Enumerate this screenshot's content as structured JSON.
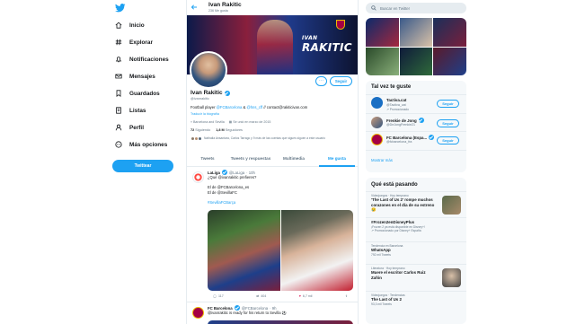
{
  "nav": {
    "items": [
      {
        "label": "Inicio",
        "icon": "home-icon"
      },
      {
        "label": "Explorar",
        "icon": "hashtag-icon"
      },
      {
        "label": "Notificaciones",
        "icon": "bell-icon"
      },
      {
        "label": "Mensajes",
        "icon": "envelope-icon"
      },
      {
        "label": "Guardados",
        "icon": "bookmark-icon"
      },
      {
        "label": "Listas",
        "icon": "list-icon"
      },
      {
        "label": "Perfil",
        "icon": "person-icon"
      },
      {
        "label": "Más opciones",
        "icon": "more-icon"
      }
    ],
    "tweet_button": "Twittear"
  },
  "header": {
    "name": "Ivan Rakitic",
    "count": "236 Me gusta"
  },
  "banner": {
    "first": "IVAN",
    "last": "RAKITIC"
  },
  "profile": {
    "more": "···",
    "follow": "Seguir",
    "name": "Ivan Rakitic",
    "handle": "@ivanrakitic",
    "bio_pre": "Football player ",
    "bio_link1": "@FCBarcelona",
    "bio_mid": " & ",
    "bio_link2": "@hns_cff",
    "bio_post": " // contact@rakiticivan.com",
    "translate": "Traducir la biografía",
    "location": "Barcelona and Sevilla",
    "joined": "Se unió en marzo de 2015",
    "following_num": "72",
    "following_label": "Siguiendo",
    "followers_num": "1,8 M",
    "followers_label": "Seguidores",
    "known": "Nathalia Ansantara, Carlos Tarrago y 9 más de las cuentas que sigues siguen a este usuario"
  },
  "tabs": [
    "Tweets",
    "Tweets y respuestas",
    "Multimedia",
    "Me gusta"
  ],
  "tweet1": {
    "name": "LaLiga",
    "handle": "@LaLiga",
    "time": "· 10h",
    "line1": "¿Qué @ivanrakitic prefieres?",
    "line2": "El de @FCBarcelona_es",
    "line3": "El de @SevillaFC",
    "hashtag": "#SevillaFCBarça",
    "reply": "117",
    "retweet": "404",
    "like": "6,7 mil"
  },
  "tweet2": {
    "name": "FC Barcelona",
    "handle": "@FCBarcelona",
    "time": "· 9h",
    "line1": "@ivanrakitic is ready for his return to Sevilla ⚽"
  },
  "search": {
    "placeholder": "Buscar en Twitter"
  },
  "who_to_follow": {
    "title": "Tal vez te guste",
    "items": [
      {
        "name": "Tactiva.cat",
        "handle": "@Tactiva_cat",
        "promo": "Promocionado",
        "button": "Seguir"
      },
      {
        "name": "Frenkie de Jong",
        "handle": "@DeJongFrenkie21",
        "promo": "",
        "button": "Seguir"
      },
      {
        "name": "FC Barcelona (Espa...",
        "handle": "@fcbarcelona_fra",
        "promo": "",
        "button": "Seguir"
      }
    ],
    "show_more": "Mostrar más"
  },
  "trends": {
    "title": "Qué está pasando",
    "items": [
      {
        "context": "Videojuegos · Hoy temprano",
        "title": "'The Last of Us 2' rompe muchos corazones en el día de su estreno 😢",
        "sub": ""
      },
      {
        "context": "",
        "title": "#Frozen2enDisneyPlus",
        "sub": "¡Frozen 2 ya está disponible en Disney+!"
      },
      {
        "context": "",
        "title": "",
        "sub": "Promocionado por Disney+ España"
      },
      {
        "context": "Tendencia en Barcelona",
        "title": "WhatsApp",
        "sub": "792 mil Tweets"
      },
      {
        "context": "Literatura · Hoy temprano",
        "title": "Muere el escritor Carlos Ruiz Zafón",
        "sub": ""
      },
      {
        "context": "Videojuegos · Tendencias",
        "title": "The Last of Us 2",
        "sub": "93,3 mil Tweets"
      }
    ]
  },
  "colors": {
    "accent": "#1da1f2",
    "text": "#14171a",
    "muted": "#657786"
  }
}
